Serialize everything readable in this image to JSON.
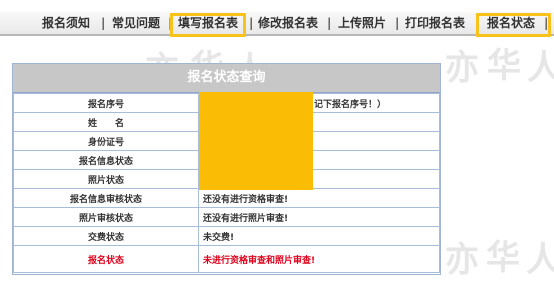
{
  "nav": {
    "items": [
      "报名须知",
      "常见问题",
      "填写报名表",
      "修改报名表",
      "上传照片",
      "打印报名表",
      "报名状态"
    ],
    "separator": "|",
    "highlight_color": "#f7c21a"
  },
  "panel": {
    "title": "报名状态查询",
    "rows": [
      {
        "label": "报名序号",
        "value": "记下报名序号！）"
      },
      {
        "label": "姓　　名",
        "value": ""
      },
      {
        "label": "身份证号",
        "value": ""
      },
      {
        "label": "报名信息状态",
        "value": ""
      },
      {
        "label": "照片状态",
        "value": ""
      },
      {
        "label": "报名信息审核状态",
        "value": "还没有进行资格审查!"
      },
      {
        "label": "照片审核状态",
        "value": "还没有进行照片审查!"
      },
      {
        "label": "交费状态",
        "value": "未交费!"
      },
      {
        "label": "报名状态",
        "value": "未进行资格审查和照片审查!"
      }
    ],
    "alert_color": "#e0001b",
    "redaction_color": "#fbbc05"
  }
}
